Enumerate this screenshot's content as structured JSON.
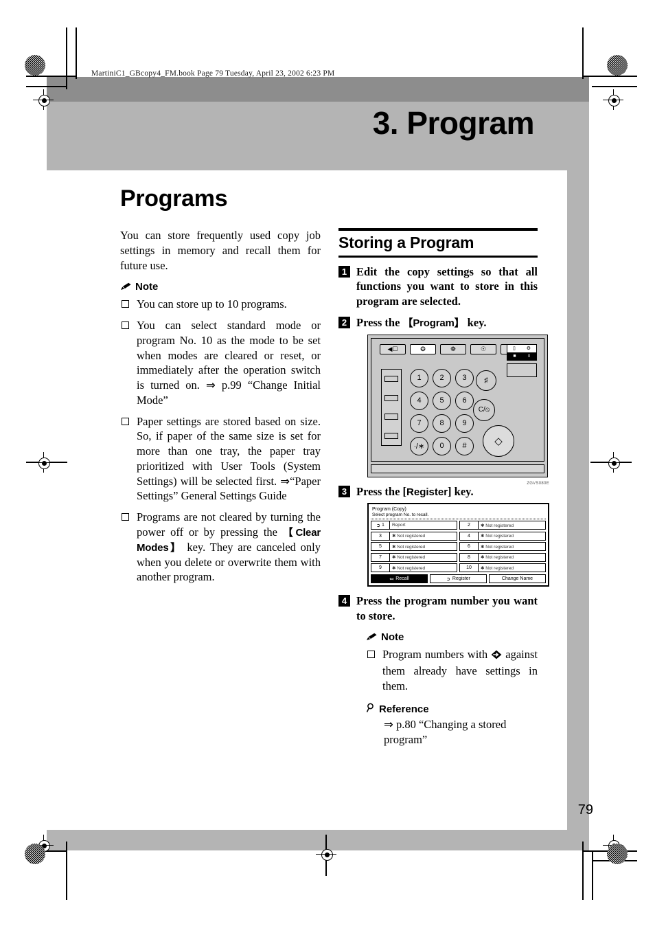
{
  "print_header": "MartiniC1_GBcopy4_FM.book  Page 79  Tuesday, April 23, 2002  6:23 PM",
  "chapter_title": "3. Program",
  "page_title": "Programs",
  "page_number": "79",
  "left_column": {
    "intro": "You can store frequently used copy job settings in memory and recall them for future use.",
    "note_label": "Note",
    "notes": [
      "You can store up to 10 programs.",
      "You can select standard mode or program No. 10 as the mode to be set when modes are cleared or reset, or immediately after the operation switch is turned on. ⇒ p.99 “Change Initial Mode”",
      "Paper settings are stored based on size. So, if paper of the same size is set for more than one tray, the paper tray prioritized with User Tools (System Settings) will be selected first. ⇒“Paper Settings” General Settings Guide",
      "Programs are not cleared by turning the power off or by pressing the 【Clear Modes】 key. They are canceled only when you delete or overwrite them with another program."
    ],
    "clear_modes_key": "Clear Modes"
  },
  "right_column": {
    "section_title": "Storing a Program",
    "steps": [
      {
        "num": "1",
        "text": "Edit the copy settings so that all functions you want to store in this program are selected."
      },
      {
        "num": "2",
        "text": "Press the 【Program】 key."
      },
      {
        "num": "3",
        "text": "Press the [Register] key."
      },
      {
        "num": "4",
        "text": "Press the program number you want to store."
      }
    ],
    "program_key": "Program",
    "register_key": "Register",
    "note_label": "Note",
    "note_text_before": "Program numbers with",
    "note_text_after": "against them already have settings in them.",
    "reference_label": "Reference",
    "reference_text": "⇒ p.80 “Changing a stored program”"
  },
  "figure_control_panel": {
    "code": "ZGVS080E",
    "keypad": [
      "1",
      "2",
      "3",
      "4",
      "5",
      "6",
      "7",
      "8",
      "9",
      "∙/∗",
      "0",
      "#"
    ],
    "hash_key": "♯",
    "clear_stop_key": "C/⦸",
    "start_key": "◇"
  },
  "figure_lcd": {
    "title": "Program (Copy)",
    "subtitle": "Select program No. to recall.",
    "rows": [
      {
        "left_num": "1",
        "left_name": "Report",
        "left_marked": true,
        "right_num": "2",
        "right_name": "✱ Not registered",
        "right_marked": false
      },
      {
        "left_num": "3",
        "left_name": "✱ Not registered",
        "left_marked": false,
        "right_num": "4",
        "right_name": "✱ Not registered",
        "right_marked": false
      },
      {
        "left_num": "5",
        "left_name": "✱ Not registered",
        "left_marked": false,
        "right_num": "6",
        "right_name": "✱ Not registered",
        "right_marked": false
      },
      {
        "left_num": "7",
        "left_name": "✱ Not registered",
        "left_marked": false,
        "right_num": "8",
        "right_name": "✱ Not registered",
        "right_marked": false
      },
      {
        "left_num": "9",
        "left_name": "✱ Not registered",
        "left_marked": false,
        "right_num": "10",
        "right_name": "✱ Not registered",
        "right_marked": false
      }
    ],
    "buttons": [
      {
        "label": "Recall",
        "selected": true
      },
      {
        "label": "Register",
        "selected": false
      },
      {
        "label": "Change Name",
        "selected": false
      }
    ]
  }
}
